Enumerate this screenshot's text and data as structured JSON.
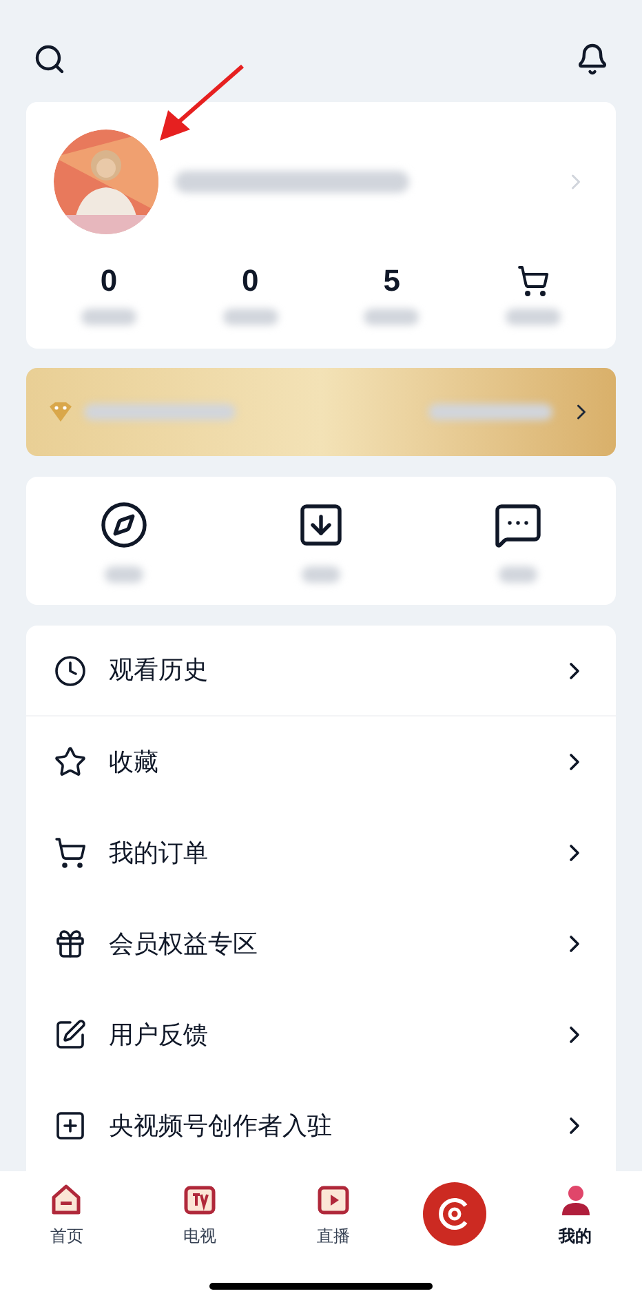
{
  "profile": {
    "stats": [
      {
        "kind": "number",
        "value": "0"
      },
      {
        "kind": "number",
        "value": "0"
      },
      {
        "kind": "number",
        "value": "5"
      },
      {
        "kind": "cart"
      }
    ]
  },
  "shortcuts": [
    {
      "kind": "compass"
    },
    {
      "kind": "download"
    },
    {
      "kind": "message"
    }
  ],
  "menu": [
    {
      "kind": "history",
      "label": "观看历史"
    },
    {
      "kind": "star",
      "label": "收藏"
    },
    {
      "kind": "cart",
      "label": "我的订单"
    },
    {
      "kind": "gift",
      "label": "会员权益专区"
    },
    {
      "kind": "edit",
      "label": "用户反馈"
    },
    {
      "kind": "add",
      "label": "央视频号创作者入驻"
    }
  ],
  "tabs": [
    {
      "kind": "home",
      "label": "首页",
      "selected": false
    },
    {
      "kind": "tv",
      "label": "电视",
      "selected": false
    },
    {
      "kind": "live",
      "label": "直播",
      "selected": false
    },
    {
      "kind": "center",
      "selected": false
    },
    {
      "kind": "me",
      "label": "我的",
      "selected": true
    }
  ]
}
